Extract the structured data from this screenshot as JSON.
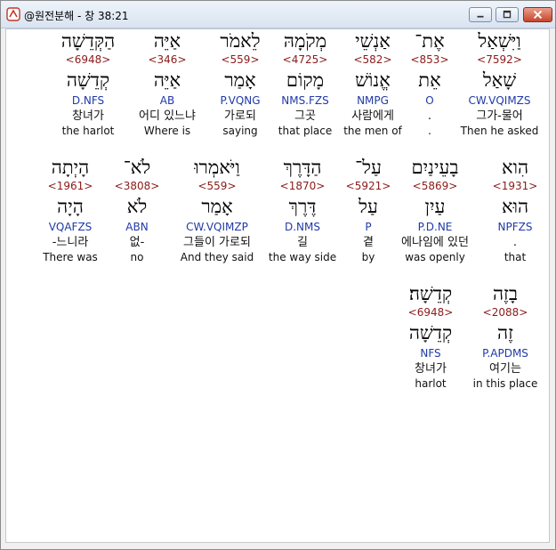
{
  "window": {
    "title": "@원전분해 - 창 38:21",
    "buttons": {
      "minimize": "minimize",
      "maximize": "maximize",
      "close": "close"
    }
  },
  "rows": [
    {
      "words": [
        {
          "hebrew": "וַיִּשְׁאַל",
          "strong": "<7592>",
          "lemma": "שָׁאַל",
          "parse": "CW.VQIMZS",
          "korean": "그가-물어",
          "english": "Then he asked",
          "selected": true
        },
        {
          "hebrew": "אֶת־",
          "strong": "<853>",
          "lemma": "אֵת",
          "parse": "O",
          "korean": ".",
          "english": "."
        },
        {
          "hebrew": "אַנְשֵׁי",
          "strong": "<582>",
          "lemma": "אֱנוֹשׁ",
          "parse": "NMPG",
          "korean": "사람에게",
          "english": "the men of"
        },
        {
          "hebrew": "מְקֹמָהּ",
          "strong": "<4725>",
          "lemma": "מָקוֹם",
          "parse": "NMS.FZS",
          "korean": "그곳",
          "english": "that place"
        },
        {
          "hebrew": "לֵאמֹר",
          "strong": "<559>",
          "lemma": "אָמַר",
          "parse": "P.VQNG",
          "korean": "가로되",
          "english": "saying"
        },
        {
          "hebrew": "אַיֵּה",
          "strong": "<346>",
          "lemma": "אַיֵּה",
          "parse": "AB",
          "korean": "어디 있느냐",
          "english": "Where is"
        },
        {
          "hebrew": "הַקְּדֵשָׁה",
          "strong": "<6948>",
          "lemma": "קְדֵשָׁה",
          "parse": "D.NFS",
          "korean": "창녀가",
          "english": "the harlot"
        }
      ]
    },
    {
      "words": [
        {
          "hebrew": "הִוא",
          "strong": "<1931>",
          "lemma": "הוּא",
          "parse": "NPFZS",
          "korean": ".",
          "english": "that"
        },
        {
          "hebrew": "בָעֵינַיִם",
          "strong": "<5869>",
          "lemma": "עַיִן",
          "parse": "P.D.NE",
          "korean": "에나임에 있던",
          "english": "was openly"
        },
        {
          "hebrew": "עַל־",
          "strong": "<5921>",
          "lemma": "עַל",
          "parse": "P",
          "korean": "곁",
          "english": "by"
        },
        {
          "hebrew": "הַדָּרֶךְ",
          "strong": "<1870>",
          "lemma": "דֶּרֶךְ",
          "parse": "D.NMS",
          "korean": "길",
          "english": "the way side"
        },
        {
          "hebrew": "וַיֹּאמְרוּ",
          "strong": "<559>",
          "lemma": "אָמַר",
          "parse": "CW.VQIMZP",
          "korean": "그들이 가로되",
          "english": "And they said"
        },
        {
          "hebrew": "לֹא־",
          "strong": "<3808>",
          "lemma": "לֹא",
          "parse": "ABN",
          "korean": "없-",
          "english": "no"
        },
        {
          "hebrew": "הָיְתָה",
          "strong": "<1961>",
          "lemma": "הָיָה",
          "parse": "VQAFZS",
          "korean": "-느니라",
          "english": "There was"
        }
      ]
    },
    {
      "words": [
        {
          "hebrew": "בָזֶה",
          "strong": "<2088>",
          "lemma": "זֶה",
          "parse": "P.APDMS",
          "korean": "여기는",
          "english": "in this place"
        },
        {
          "hebrew": "קְדֵשָׁה׃",
          "strong": "<6948>",
          "lemma": "קְדֵשָׁה",
          "parse": "NFS",
          "korean": "창녀가",
          "english": "harlot"
        }
      ]
    }
  ]
}
